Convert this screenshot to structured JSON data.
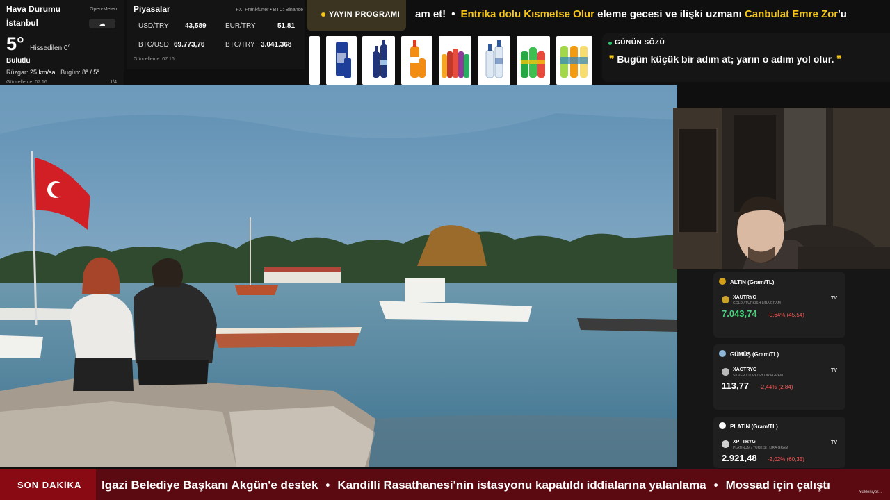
{
  "weather": {
    "title": "Hava Durumu",
    "source": "Open-Meteo",
    "city": "İstanbul",
    "temp": "5°",
    "feels": "Hissedilen 0°",
    "condition": "Bulutlu",
    "wind_label": "Rüzgar:",
    "wind_value": "25 km/sa",
    "today_label": "Bugün:",
    "today_value": "8° / 5°",
    "updated": "Güncelleme: 07:16",
    "page": "1/4",
    "icon": "cloud-icon"
  },
  "markets": {
    "title": "Piyasalar",
    "source": "FX: Frankfurter • BTC: Binance",
    "rows": [
      {
        "label": "USD/TRY",
        "value": "43,589"
      },
      {
        "label": "EUR/TRY",
        "value": "51,81"
      },
      {
        "label": "BTC/USD",
        "value": "69.773,76"
      },
      {
        "label": "BTC/TRY",
        "value": "3.041.368"
      }
    ],
    "updated": "Güncelleme: 07:16"
  },
  "program": {
    "label": "YAYIN PROGRAMI"
  },
  "top_ticker": {
    "lead": "am et!",
    "item_yellow": "Entrika dolu Kısmetse Olur",
    "item_white": " eleme gecesi ve ilişki uzmanı ",
    "item_yellow2": "Canbulat Emre Zor",
    "item_tail": "'u"
  },
  "quote": {
    "label": "GÜNÜN SÖZÜ",
    "open": "❞",
    "text": " Bugün küçük bir adım at; yarın o adım yol olur. ",
    "close": "❞"
  },
  "metals": [
    {
      "name": "ALTIN (Gram/TL)",
      "symbol": "XAUTRYG",
      "sub": "GOLD / TURKISH LIRA GRAM",
      "price": "7.043,74",
      "change": "-0,64% (45,54)",
      "medal_color": "#d4a017",
      "price_color": "#46d17a"
    },
    {
      "name": "GÜMÜŞ (Gram/TL)",
      "symbol": "XAGTRYG",
      "sub": "SILVER / TURKISH LIRA GRAM",
      "price": "113,77",
      "change": "-2,44% (2,84)",
      "medal_color": "#8fb8d8",
      "price_color": "#ffffff"
    },
    {
      "name": "PLATİN (Gram/TL)",
      "symbol": "XPTTRYG",
      "sub": "PLATINUM / TURKISH LIRA GRAM",
      "price": "2.921,48",
      "change": "-2,02% (60,35)",
      "medal_color": "#ffffff",
      "price_color": "#ffffff"
    }
  ],
  "tv_label": "TV",
  "breaking": {
    "tag": "SON DAKİKA",
    "items": [
      "lgazi Belediye Başkanı Akgün'e destek",
      "Kandilli Rasathanesi'nin istasyonu kapatıldı iddialarına yalanlama",
      "Mossad için çalıştı"
    ],
    "separator": "•",
    "watermark": "Yükleniyor..."
  },
  "colors": {
    "accent_yellow": "#f5c518",
    "breaking_red": "#8a0a14",
    "green": "#2ecc71"
  }
}
